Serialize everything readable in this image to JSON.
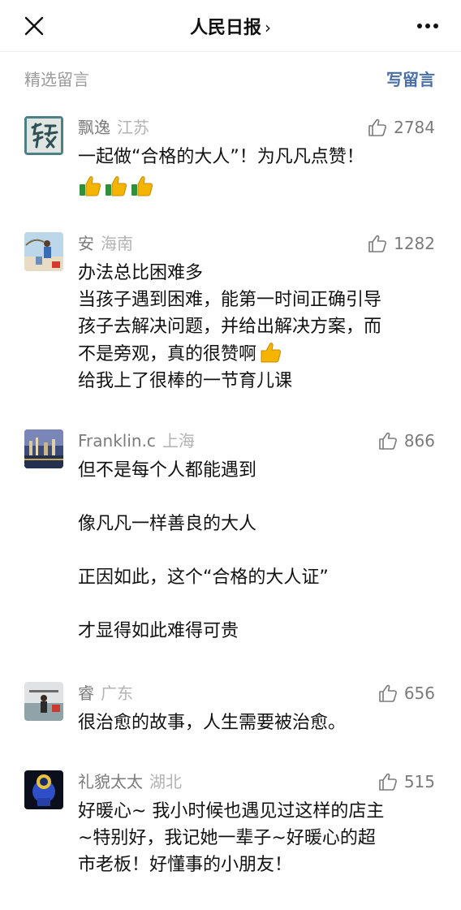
{
  "header": {
    "title": "人民日报",
    "title_chevron": "›"
  },
  "section": {
    "left_label": "精选留言",
    "right_label": "写留言"
  },
  "comments": [
    {
      "nickname": "飘逸",
      "location": "江苏",
      "likes": "2784",
      "lines": [
        "一起做“合格的大人”！为凡凡点赞！"
      ],
      "emoji": [
        "thumbs-up",
        "thumbs-up",
        "thumbs-up"
      ]
    },
    {
      "nickname": "安",
      "location": "海南",
      "likes": "1282",
      "lines": [
        "办法总比困难多",
        "当孩子遇到困难，能第一时间正确引导",
        "孩子去解决问题，并给出解决方案，而",
        "不是旁观，真的很赞啊",
        "给我上了很棒的一节育儿课"
      ]
    },
    {
      "nickname": "Franklin.c",
      "location": "上海",
      "likes": "866",
      "lines": [
        "但不是每个人都能遇到",
        "",
        "像凡凡一样善良的大人",
        "",
        "正因如此，这个“合格的大人证”",
        "",
        "才显得如此难得可贵"
      ]
    },
    {
      "nickname": "睿",
      "location": "广东",
      "likes": "656",
      "lines": [
        "很治愈的故事，人生需要被治愈。"
      ]
    },
    {
      "nickname": "礼貌太太",
      "location": "湖北",
      "likes": "515",
      "lines": [
        "好暖心~ 我小时候也遇见过这样的店主",
        "~特别好，我记她一辈子~好暖心的超",
        "市老板！好懂事的小朋友！"
      ]
    }
  ],
  "colors": {
    "link": "#4a6ea8",
    "muted": "#7b7b7b",
    "location": "#b3b3b3"
  }
}
